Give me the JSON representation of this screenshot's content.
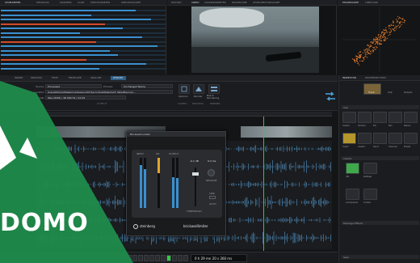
{
  "top_tabs": {
    "left": [
      "LEVELMETER",
      "METADATA",
      "MARKERS",
      "CLIPS",
      "SPECTROMETER",
      "SPECTROSCOPE"
    ],
    "mid": [
      "HISTORY",
      "VIDEO",
      "LOUDNESSMETER",
      "WAVESCOPE",
      "LEVELSPECTROSCOPE"
    ],
    "right": [
      "PHASESCOPE",
      "TIMECODE"
    ]
  },
  "level_meter": {
    "levels": [
      0.82,
      0.55,
      0.91,
      0.63,
      0.74,
      0.48,
      0.86,
      0.58,
      0.95,
      0.66,
      0.71,
      0.52,
      0.88,
      0.6
    ]
  },
  "ribbon": {
    "tabs": [
      "INSERT",
      "PROCESS",
      "FADE",
      "ENVELOPE",
      "ANALYZE",
      "RENDER"
    ],
    "active_tab": "RENDER",
    "fields": [
      {
        "label": "Source",
        "value": "Processed"
      },
      {
        "label": "Location",
        "value": "Users/Mixing/Mastering/Session/03 Recording/Material/3_Take/Bounce/..."
      },
      {
        "label": "Format",
        "value": "Wav (PCM) / 48 000 Hz / 24 bit"
      }
    ],
    "selector_label": "Process",
    "selector_value": "Unchanged Name",
    "options_label": "Options",
    "buttons": [
      "Options",
      "Render",
      "Batch Rendering"
    ],
    "groups": [
      "OUTPUT",
      "CONFIG",
      "PROCESS",
      "RENDER"
    ]
  },
  "inspector_tabs": [
    "INSPECTOR",
    "MASTERSECTION"
  ],
  "inspector": {
    "top_buttons": [
      "Track",
      "Clip",
      "Output"
    ],
    "section_clip": "Clip",
    "clip_buttons": [
      "Inserts",
      "Volume",
      "EQ",
      "Pan",
      "Stereo"
    ],
    "clip_row2": [
      "Insert",
      "Inserts",
      "Send",
      "Channel",
      "Preset"
    ],
    "section_inserts": "Inserts",
    "inserts": [
      "VSI",
      "DeEsser",
      "Compressor",
      "Limiter"
    ],
    "section_montage": "Montage Effects",
    "section_spec": "Spec"
  },
  "plugin": {
    "title": "Brickwall Limiter",
    "labels": {
      "input": "INPUT",
      "gr": "GR",
      "output": "OUTPUT",
      "threshold": "-0.1 dB",
      "release": "0.4 ms",
      "release_label": "RELEASE",
      "threshold_label": "THRESHOLD",
      "link": "LINK",
      "auto": "AUTO"
    },
    "brand": "steinberg",
    "name": "brickwalllimiter",
    "input_level": 0.85,
    "output_level": 0.62,
    "gr_level": 0.3
  },
  "transport": {
    "time": "0 h 29 mn 20 s 360 ms"
  },
  "watermark": {
    "text": "DOMO"
  },
  "colors": {
    "accent": "#1f8a4b",
    "selection": "#3a8fd0",
    "meter_green": "#2ecc40",
    "orange": "#e07a2a"
  }
}
